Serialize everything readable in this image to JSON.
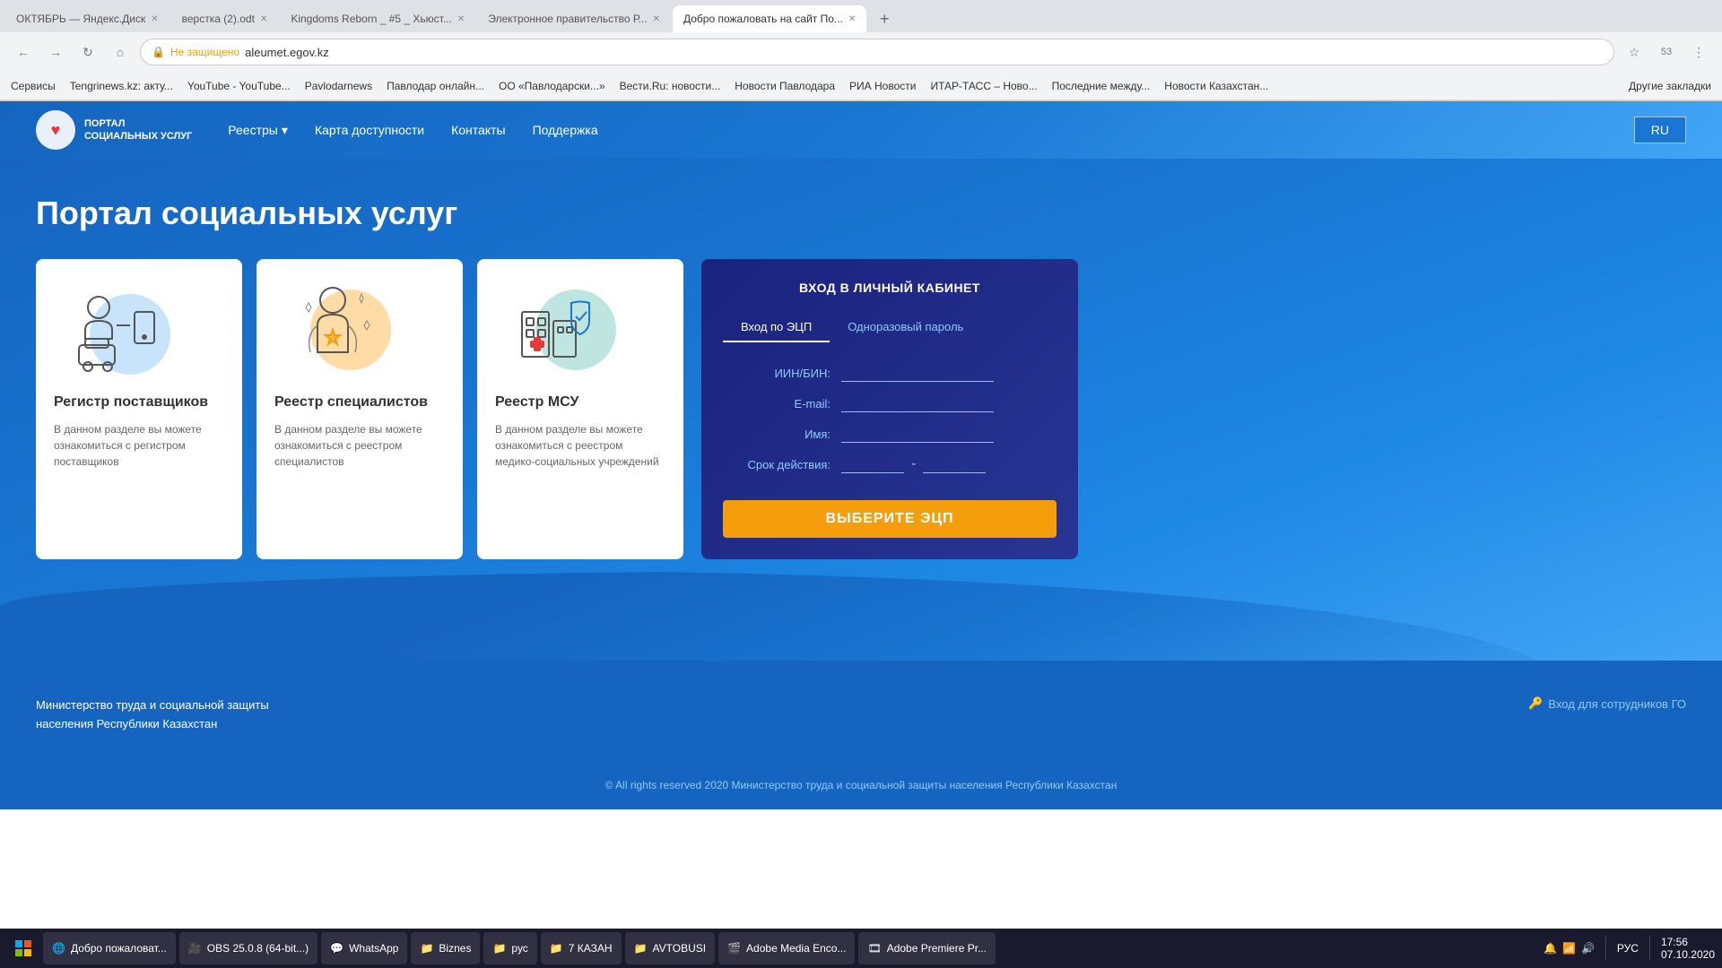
{
  "browser": {
    "tabs": [
      {
        "label": "ОКТЯБРЬ — Яндекс.Диск",
        "active": false
      },
      {
        "label": "верстка (2).odt",
        "active": false
      },
      {
        "label": "Kingdoms Reborn _ #5 _ Хьюст...",
        "active": false
      },
      {
        "label": "Электронное правительство Р...",
        "active": false
      },
      {
        "label": "Добро пожаловать на сайт По...",
        "active": true
      }
    ],
    "url": "aleumet.egov.kz",
    "not_secure": "Не защищено",
    "bookmarks": [
      "Сервисы",
      "Tengrinews.kz: акту...",
      "YouTube - YouTube...",
      "Pavlodarnews",
      "Павлодар онлайн...",
      "ОО «Павлодарски...»",
      "Вести.Ru: новости...",
      "Новости Павлодара",
      "РИА Новости",
      "ИТАР-ТАСС – Ново...",
      "Последние между...",
      "Новости Казахстан...",
      "Другие закладки"
    ]
  },
  "site": {
    "logo_line1": "ПОРТАЛ",
    "logo_line2": "СОЦИАЛЬНЫХ УСЛУГ",
    "nav": {
      "registries": "Реестры",
      "accessibility": "Карта доступности",
      "contacts": "Контакты",
      "support": "Поддержка",
      "lang": "RU"
    },
    "hero_title": "Портал социальных услуг",
    "cards": [
      {
        "title": "Регистр поставщиков",
        "desc": "В данном разделе вы можете ознакомиться с регистром поставщиков"
      },
      {
        "title": "Реестр специалистов",
        "desc": "В данном разделе вы можете ознакомиться с реестром специалистов"
      },
      {
        "title": "Реестр МСУ",
        "desc": "В данном разделе вы можете ознакомиться с реестром медико-социальных учреждений"
      }
    ],
    "login": {
      "title": "ВХОД В ЛИЧНЫЙ КАБИНЕТ",
      "tab1": "Вход по ЭЦП",
      "tab2": "Одноразовый пароль",
      "label_iin": "ИИН/БИН:",
      "label_email": "E-mail:",
      "label_name": "Имя:",
      "label_validity": "Срок действия:",
      "btn": "Выберите ЭЦП"
    },
    "footer": {
      "ministry_line1": "Министерство труда и социальной защиты",
      "ministry_line2": "населения Республики Казахстан",
      "staff_login": "Вход для сотрудников ГО",
      "copyright": "© All rights reserved 2020 Министерство труда и социальной защиты населения Республики Казахстан"
    }
  },
  "taskbar": {
    "items": [
      {
        "label": "Добро пожаловат...",
        "icon": "browser"
      },
      {
        "label": "OBS 25.0.8 (64-bit...)",
        "icon": "obs"
      },
      {
        "label": "WhatsApp",
        "icon": "whatsapp"
      },
      {
        "label": "Biznes",
        "icon": "folder"
      },
      {
        "label": "рус",
        "icon": "folder"
      },
      {
        "label": "7 КАЗАН",
        "icon": "folder"
      },
      {
        "label": "AVTOBUSI",
        "icon": "folder"
      },
      {
        "label": "Adobe Media Enco...",
        "icon": "adobe"
      },
      {
        "label": "Adobe Premiere Pr...",
        "icon": "adobe"
      }
    ],
    "time": "17:56",
    "date": "07.10.2020",
    "lang": "РУС"
  }
}
